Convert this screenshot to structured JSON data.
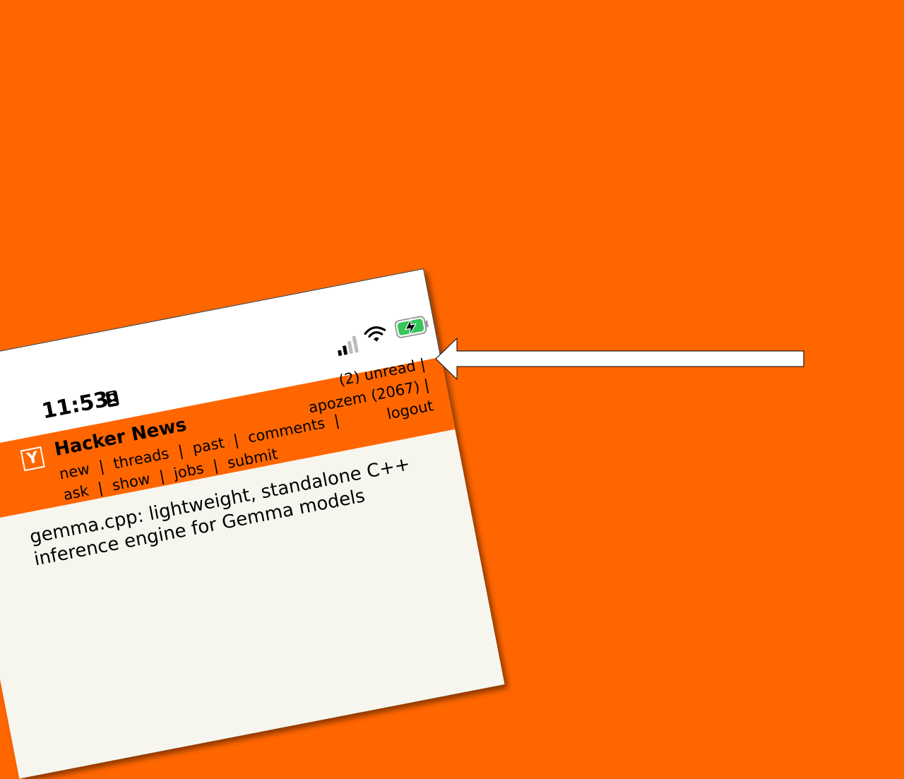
{
  "status_bar": {
    "time": "11:53",
    "icons": [
      "person-badge-icon",
      "cellular-signal-icon",
      "wifi-icon",
      "battery-charging-icon"
    ],
    "battery_color": "#34c759"
  },
  "header": {
    "logo_letter": "Y",
    "site_title": "Hacker News",
    "nav_row1": [
      "new",
      "|",
      "threads",
      "|",
      "past",
      "|",
      "comments",
      "|"
    ],
    "nav_row2": [
      "ask",
      "|",
      "show",
      "|",
      "jobs",
      "|",
      "submit"
    ],
    "unread": "(2) unread",
    "sep1": "|",
    "user": "apozem (2067)",
    "sep2": "|",
    "logout": "logout"
  },
  "story": {
    "title_line1": "gemma.cpp: lightweight, standalone C++",
    "title_line2": "inference engine for Gemma models"
  },
  "colors": {
    "background": "#ff6600",
    "page": "#f6f6ef",
    "arrow_fill": "#ffffff"
  },
  "annotation": "arrow-pointing-left"
}
